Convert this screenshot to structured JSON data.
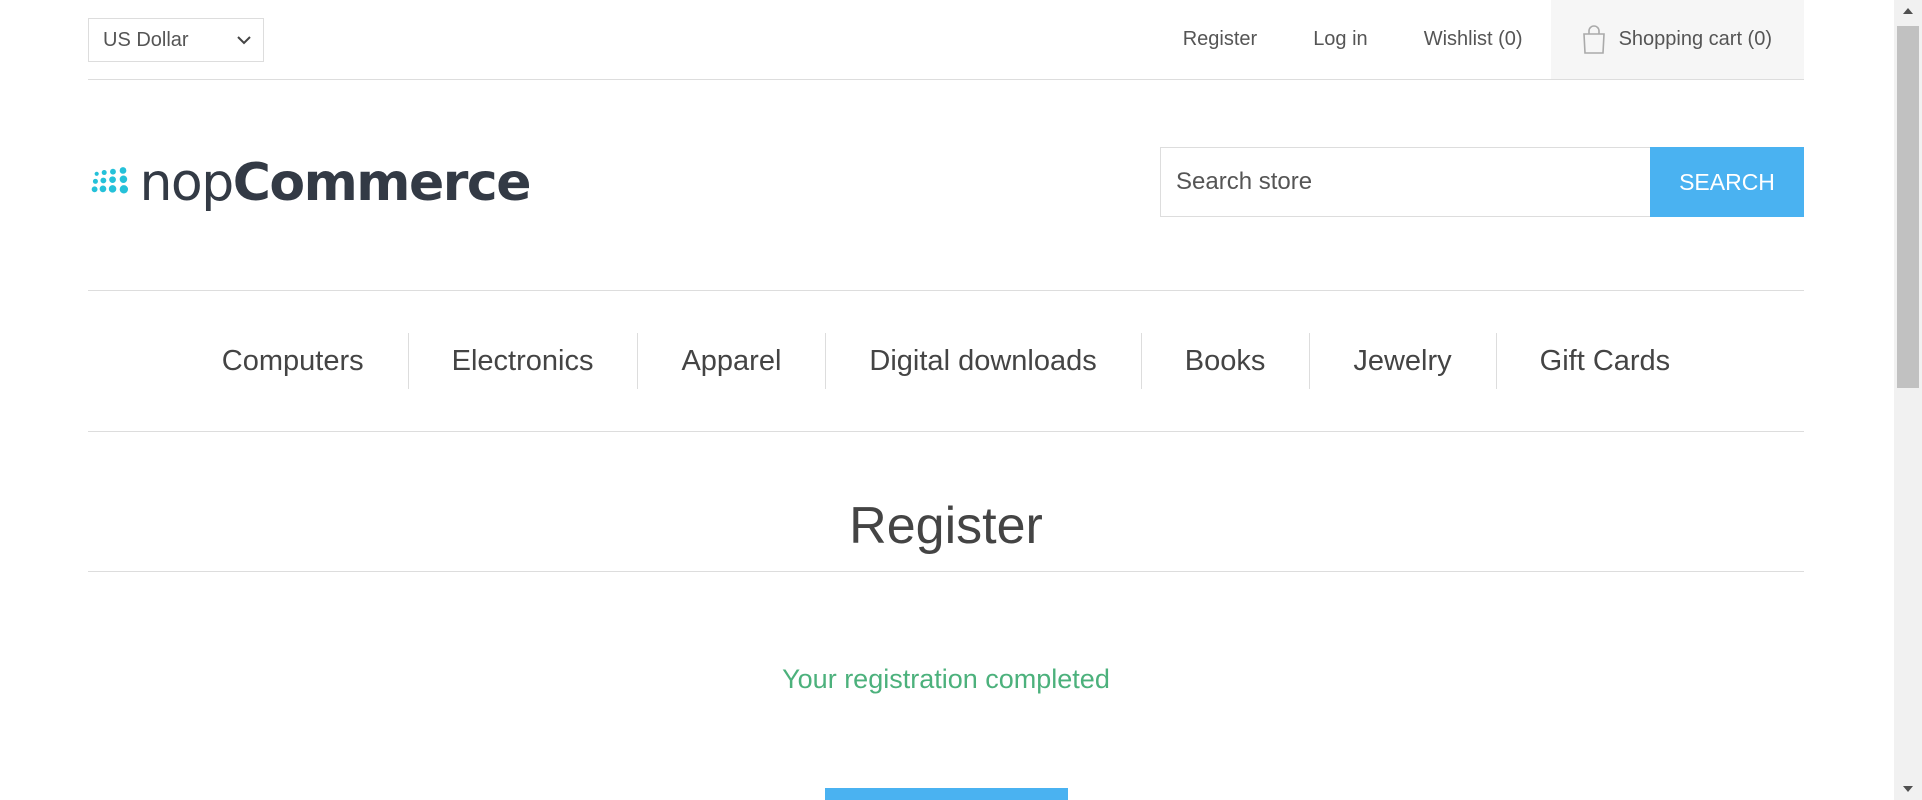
{
  "header": {
    "currency": "US Dollar",
    "links": {
      "register": "Register",
      "login": "Log in",
      "wishlist": "Wishlist (0)",
      "cart": "Shopping cart (0)"
    }
  },
  "logo": {
    "nop": "nop",
    "commerce": "Commerce",
    "dot_color": "#25c1d9"
  },
  "search": {
    "placeholder": "Search store",
    "button": "Search"
  },
  "menu": {
    "items": [
      "Computers",
      "Electronics",
      "Apparel",
      "Digital downloads",
      "Books",
      "Jewelry",
      "Gift Cards"
    ]
  },
  "page": {
    "title": "Register",
    "result": "Your registration completed"
  },
  "colors": {
    "accent": "#4ab2f1",
    "success": "#4cb17c"
  }
}
